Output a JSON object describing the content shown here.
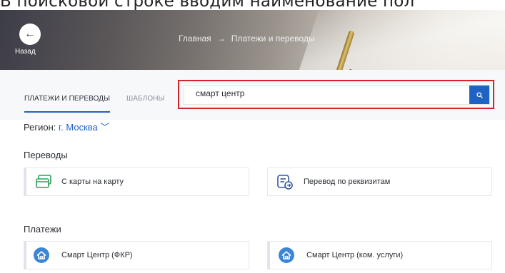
{
  "caption": "В поисковой строке вводим наименование пол",
  "header": {
    "back_label": "Назад",
    "breadcrumb": [
      "Главная",
      "Платежи и переводы"
    ],
    "breadcrumb_separator": "→"
  },
  "tabs": [
    {
      "label": "ПЛАТЕЖИ И ПЕРЕВОДЫ",
      "active": true
    },
    {
      "label": "ШАБЛОНЫ",
      "active": false
    }
  ],
  "search": {
    "value": "смарт центр",
    "button_icon": "search-icon"
  },
  "region": {
    "label": "Регион:",
    "value": "г. Москва"
  },
  "sections": {
    "transfers": {
      "title": "Переводы",
      "items": [
        {
          "label": "С карты на карту",
          "icon": "card-transfer-icon"
        },
        {
          "label": "Перевод по реквизитам",
          "icon": "requisites-transfer-icon"
        }
      ]
    },
    "payments": {
      "title": "Платежи",
      "items": [
        {
          "label": "Смарт Центр (ФКР)",
          "icon": "house-icon"
        },
        {
          "label": "Смарт Центр (ком. услуги)",
          "icon": "house-icon"
        }
      ]
    }
  },
  "colors": {
    "accent": "#1e63c4",
    "highlight": "#d6232a",
    "card_icon_green": "#2f9e5a"
  }
}
